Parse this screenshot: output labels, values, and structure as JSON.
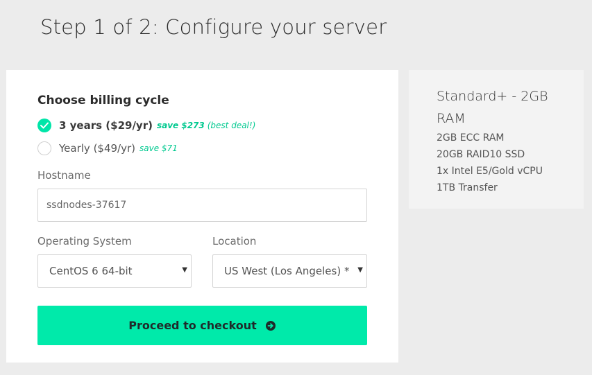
{
  "page": {
    "title": "Step 1 of 2: Configure your server"
  },
  "billing": {
    "heading": "Choose billing cycle",
    "options": [
      {
        "label": "3 years ($29/yr)",
        "save_text": "save $273",
        "note": "(best deal!)",
        "selected": true
      },
      {
        "label": "Yearly ($49/yr)",
        "save_text": "save $71",
        "note": "",
        "selected": false
      }
    ]
  },
  "hostname": {
    "label": "Hostname",
    "value": "ssdnodes-37617"
  },
  "os": {
    "label": "Operating System",
    "selected": "CentOS 6 64-bit"
  },
  "location": {
    "label": "Location",
    "selected": "US West (Los Angeles) *"
  },
  "checkout": {
    "label": "Proceed to checkout",
    "icon": "arrow-circle-right-icon"
  },
  "summary": {
    "plan_name": "Standard+ - 2GB RAM",
    "specs": [
      "2GB ECC RAM",
      "20GB RAID10 SSD",
      "1x Intel E5/Gold vCPU",
      "1TB Transfer"
    ]
  },
  "colors": {
    "accent": "#00eaaa",
    "save_text": "#00c98f",
    "background": "#ececec"
  }
}
